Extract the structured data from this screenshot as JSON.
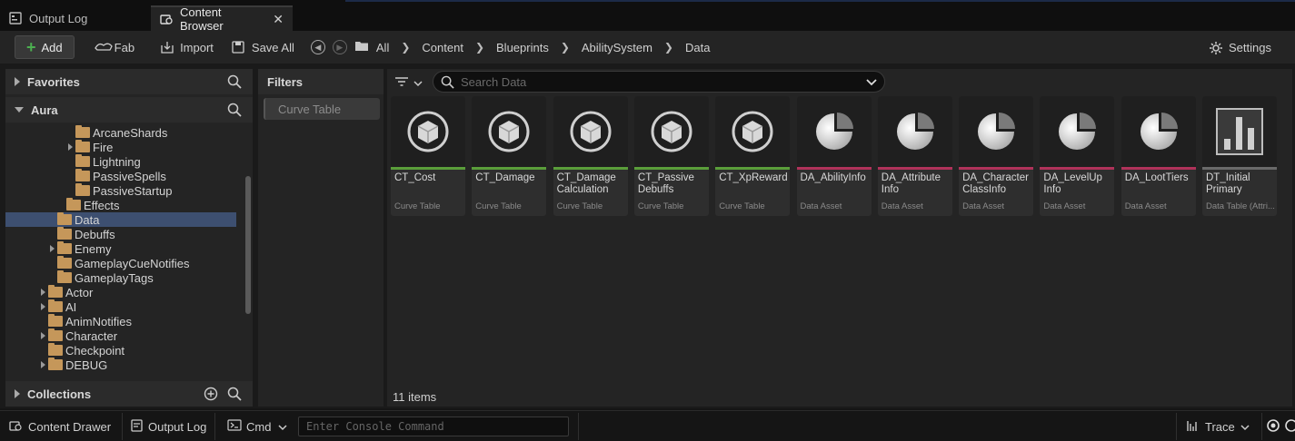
{
  "tabs": [
    {
      "label": "Output Log",
      "icon": "output-log-icon"
    },
    {
      "label": "Content Browser",
      "icon": "content-browser-icon",
      "active": true
    }
  ],
  "toolbar": {
    "add_label": "Add",
    "fab_label": "Fab",
    "import_label": "Import",
    "save_all_label": "Save All",
    "settings_label": "Settings"
  },
  "breadcrumbs": [
    "All",
    "Content",
    "Blueprints",
    "AbilitySystem",
    "Data"
  ],
  "sidebar": {
    "favorites_label": "Favorites",
    "root_label": "Aura",
    "collections_label": "Collections",
    "tree": [
      {
        "label": "ArcaneShards",
        "expand": false
      },
      {
        "label": "Fire",
        "expand": true
      },
      {
        "label": "Lightning",
        "expand": false
      },
      {
        "label": "PassiveSpells",
        "expand": false
      },
      {
        "label": "PassiveStartup",
        "expand": false
      },
      {
        "label": "Effects",
        "expand": false
      },
      {
        "label": "Data",
        "expand": false,
        "selected": true
      },
      {
        "label": "Debuffs",
        "expand": false
      },
      {
        "label": "Enemy",
        "expand": true
      },
      {
        "label": "GameplayCueNotifies",
        "expand": false
      },
      {
        "label": "GameplayTags",
        "expand": false
      },
      {
        "label": "Actor",
        "expand": true
      },
      {
        "label": "AI",
        "expand": true
      },
      {
        "label": "AnimNotifies",
        "expand": false
      },
      {
        "label": "Character",
        "expand": true
      },
      {
        "label": "Checkpoint",
        "expand": false
      },
      {
        "label": "DEBUG",
        "expand": true
      }
    ]
  },
  "filters": {
    "header": "Filters",
    "active_filter": "Curve Table"
  },
  "content": {
    "search_placeholder": "Search Data",
    "item_count": "11 items",
    "assets": [
      {
        "name": "CT_Cost",
        "type": "Curve Table",
        "kind": "curve"
      },
      {
        "name": "CT_Damage",
        "type": "Curve Table",
        "kind": "curve"
      },
      {
        "name": "CT_Damage Calculation Coefficients",
        "type": "Curve Table",
        "kind": "curve"
      },
      {
        "name": "CT_Passive Debuffs",
        "type": "Curve Table",
        "kind": "curve"
      },
      {
        "name": "CT_XpReward",
        "type": "Curve Table",
        "kind": "curve"
      },
      {
        "name": "DA_AbilityInfo",
        "type": "Data Asset",
        "kind": "asset"
      },
      {
        "name": "DA_Attribute Info",
        "type": "Data Asset",
        "kind": "asset"
      },
      {
        "name": "DA_Character ClassInfo",
        "type": "Data Asset",
        "kind": "asset"
      },
      {
        "name": "DA_LevelUp Info",
        "type": "Data Asset",
        "kind": "asset"
      },
      {
        "name": "DA_LootTiers",
        "type": "Data Asset",
        "kind": "asset"
      },
      {
        "name": "DT_Initial Primary Values",
        "type": "Data Table (Attri...",
        "kind": "table"
      }
    ]
  },
  "colors": {
    "curve_table_accent": "#5a9e3a",
    "data_asset_accent": "#b0325a",
    "data_table_accent": "#6a6a6a",
    "selection": "#3d4f70",
    "add_plus": "#4caf50"
  },
  "statusbar": {
    "content_drawer_label": "Content Drawer",
    "output_log_label": "Output Log",
    "cmd_label": "Cmd",
    "console_placeholder": "Enter Console Command",
    "trace_label": "Trace"
  }
}
